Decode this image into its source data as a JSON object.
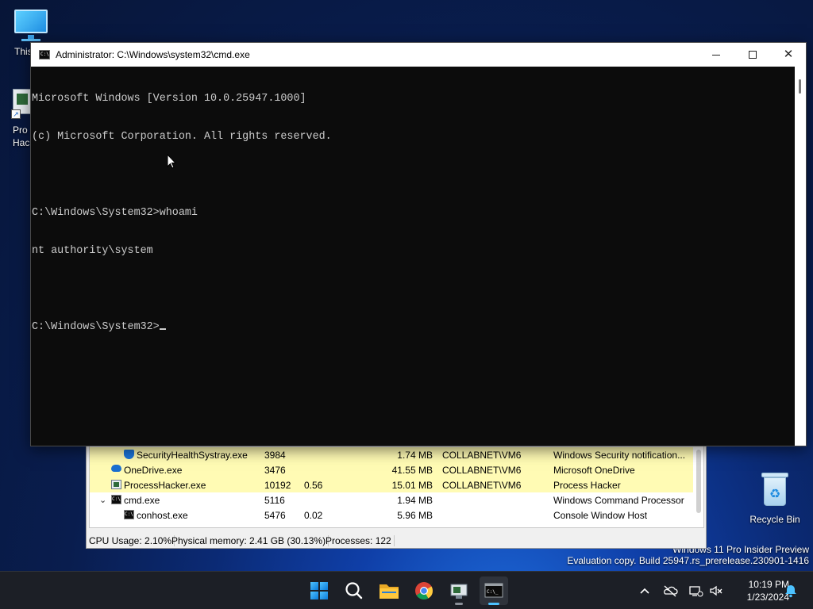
{
  "desktop": {
    "this_pc_label": "This",
    "process_hacker_label_1": "Pro",
    "process_hacker_label_2": "Hac",
    "recycle_bin_label": "Recycle Bin",
    "watermark_line1": "Windows 11 Pro Insider Preview",
    "watermark_line2": "Evaluation copy. Build 25947.rs_prerelease.230901-1416"
  },
  "cmd": {
    "title": "Administrator: C:\\Windows\\system32\\cmd.exe",
    "icon_text": "C:\\",
    "lines": [
      "Microsoft Windows [Version 10.0.25947.1000]",
      "(c) Microsoft Corporation. All rights reserved.",
      "",
      "C:\\Windows\\System32>whoami",
      "nt authority\\system",
      "",
      "C:\\Windows\\System32>"
    ]
  },
  "process_hacker": {
    "rows": [
      {
        "name": "SecurityHealthSystray.exe",
        "pid": "3984",
        "cpu": "",
        "mem": "1.74 MB",
        "user": "COLLABNET\\VM6",
        "desc": "Windows Security notification...",
        "icon": "shield-icon"
      },
      {
        "name": "OneDrive.exe",
        "pid": "3476",
        "cpu": "",
        "mem": "41.55 MB",
        "user": "COLLABNET\\VM6",
        "desc": "Microsoft OneDrive",
        "icon": "cloud-icon"
      },
      {
        "name": "ProcessHacker.exe",
        "pid": "10192",
        "cpu": "0.56",
        "mem": "15.01 MB",
        "user": "COLLABNET\\VM6",
        "desc": "Process Hacker",
        "icon": "process-hacker-icon"
      },
      {
        "name": "cmd.exe",
        "pid": "5116",
        "cpu": "",
        "mem": "1.94 MB",
        "user": "",
        "desc": "Windows Command Processor",
        "icon": "console-icon"
      },
      {
        "name": "conhost.exe",
        "pid": "5476",
        "cpu": "0.02",
        "mem": "5.96 MB",
        "user": "",
        "desc": "Console Window Host",
        "icon": "console-icon"
      }
    ],
    "status": {
      "cpu": "CPU Usage: 2.10%",
      "memory": "Physical memory: 2.41 GB (30.13%)",
      "processes": "Processes: 122"
    }
  },
  "taskbar": {
    "time": "10:19 PM",
    "date": "1/23/2024"
  },
  "colors": {
    "cmd_bg": "#0c0c0c",
    "cmd_text": "#cccccc",
    "highlight_row": "#fffbb4",
    "taskbar": "#1c1f26",
    "accent": "#4cc2ff"
  }
}
